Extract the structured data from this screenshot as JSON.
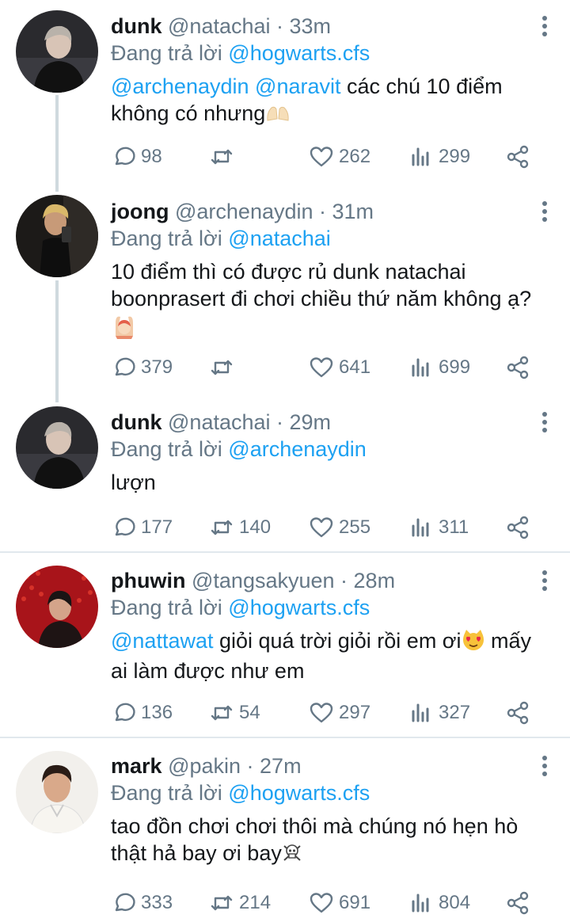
{
  "tweets": [
    {
      "name": "dunk",
      "handle": "@natachai",
      "time": "33m",
      "reply_label": "Đang trả lời",
      "reply_to": "@hogwarts.cfs",
      "mention1": "@archenaydin",
      "mention2": "@naravit",
      "text1": " các chú 10 điểm",
      "text2": "không có nhưng",
      "replies": "98",
      "retweets": "",
      "likes": "262",
      "views": "299"
    },
    {
      "name": "joong",
      "handle": "@archenaydin",
      "time": "31m",
      "reply_label": "Đang trả lời",
      "reply_to": "@natachai",
      "text1": "10 điểm thì có được rủ dunk natachai",
      "text2": "boonprasert đi chơi chiều thứ năm không ạ?",
      "replies": "379",
      "retweets": "",
      "likes": "641",
      "views": "699"
    },
    {
      "name": "dunk",
      "handle": "@natachai",
      "time": "29m",
      "reply_label": "Đang trả lời",
      "reply_to": "@archenaydin",
      "text1": "lượn",
      "replies": "177",
      "retweets": "140",
      "likes": "255",
      "views": "311"
    },
    {
      "name": "phuwin",
      "handle": "@tangsakyuen",
      "time": "28m",
      "reply_label": "Đang trả lời",
      "reply_to": "@hogwarts.cfs",
      "mention1": "@nattawat",
      "text1": " giỏi quá trời giỏi rồi em ơi",
      "text1b": " mấy",
      "text2": "ai làm được như em",
      "replies": "136",
      "retweets": "54",
      "likes": "297",
      "views": "327"
    },
    {
      "name": "mark",
      "handle": "@pakin",
      "time": "27m",
      "reply_label": "Đang trả lời",
      "reply_to": "@hogwarts.cfs",
      "text1": "tao đồn chơi chơi thôi mà chúng nó hẹn hò",
      "text2": "thật hả bay ơi bay",
      "replies": "333",
      "retweets": "214",
      "likes": "691",
      "views": "804"
    }
  ],
  "separator": " · ",
  "icons": {
    "reply": "speech-bubble-icon",
    "retweet": "retweet-icon",
    "like": "heart-icon",
    "views": "bar-chart-icon",
    "share": "share-icon",
    "more": "vertical-dots-icon"
  },
  "colors": {
    "link": "#1da1f2",
    "muted": "#657786",
    "text": "#14171a"
  }
}
